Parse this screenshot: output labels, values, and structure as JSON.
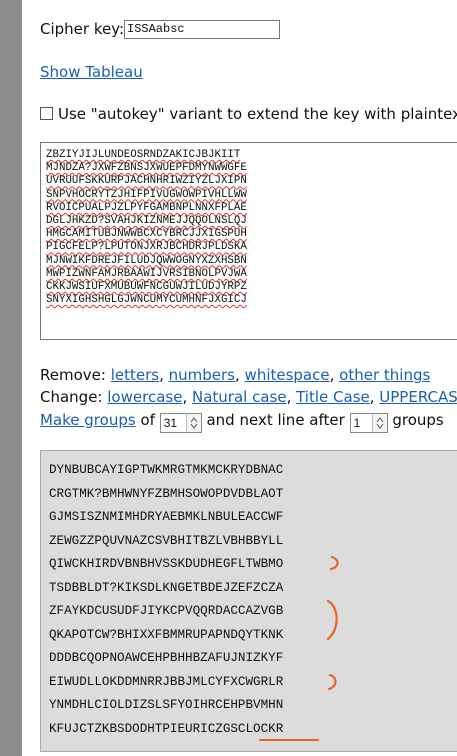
{
  "cipher_key": {
    "label": "Cipher key:",
    "value": "ISSAabsc"
  },
  "show_tableau": "Show Tableau",
  "autokey": {
    "label": "Use \"autokey\" variant to extend the key with plaintext",
    "checked": false
  },
  "input_lines": [
    "ZBZIYJIJLUNDEOSRNDZAKICJBJKIIT",
    "MJNDZA?JXWFZBNSJXWUEPFDMYNWWGFE",
    "UVRUUFSKKURPJACHNHRIWZIYZLJXIPN",
    "SNPVHOCRYTZJHIFPIVUGWOWPIVHLLWW",
    "RVOICPUALPJZLPYFGAMBNPLNNXFPLAE",
    "DGLJHKZD?SVAHJKIZNMEJJQQOLNSLQJ",
    "HMGCAMITUBJNWWBCXCYBRCJJXIGSPUH",
    "PIGCFELP?LPUTONJXRJBCHDRJPLDSKA",
    "MJNWIKFDREJFILUDJQWWOGNYXZXHSBN",
    "MWPIZWNFAMJRBAAWIJVRSIBNOLPVJWA",
    "CKKJWSIUFXMUBUWFNCGUWJILUDJYRPZ",
    "SNYXIGHSHGLGJWNCUMYCUMHNFJXGICJ"
  ],
  "remove": {
    "label": "Remove:",
    "items": [
      "letters",
      "numbers",
      "whitespace",
      "other things"
    ],
    "sep": ", "
  },
  "change": {
    "label": "Change:",
    "items": [
      "lowercase",
      "Natural case",
      "Title Case",
      "UPPERCASE"
    ],
    "sep": ", "
  },
  "groups": {
    "make_groups": "Make groups",
    "of": "of",
    "group_size": "31",
    "and_next_line": "and next line after",
    "line_after": "1",
    "groups_word": "groups"
  },
  "output_lines": [
    "DYNBUBCAYIGPTWKMRGTMKMCKRYDBNAC",
    "CRGTMK?BMHWNYFZBMHSOWOPDVDBLAOT",
    "GJMSISZNMIMHDRYAEBMKLNBULEACCWF",
    "ZEWGZZPQUVNAZCSVBHITBZLVBHBBYLL",
    "QIWCKHIRDVBNBHVSSKDUDHEGFLTWBMO",
    "TSDBBLDT?KIKSDLKNGETBDEJZEFZCZA",
    "ZFAYKDCUSUDFJIYKCPVQQRDACCAZVGB",
    "QKAPOTCW?BHIXXFBMMRUPAPNDQYTKNK",
    "DDDBCQOPNOAWCEHPBHHBZAFUJNIZKYF",
    "EIWUDLLOKDDMNRRJBBJMLCYFXCWGRLR",
    "YNMDHLCIOLDIZSLSFYOIHRCEHPBVMHN",
    "KFUJCTZKBSDODHTPIEURICZGSCLOCKR"
  ],
  "annotation_color": "#e8651f"
}
